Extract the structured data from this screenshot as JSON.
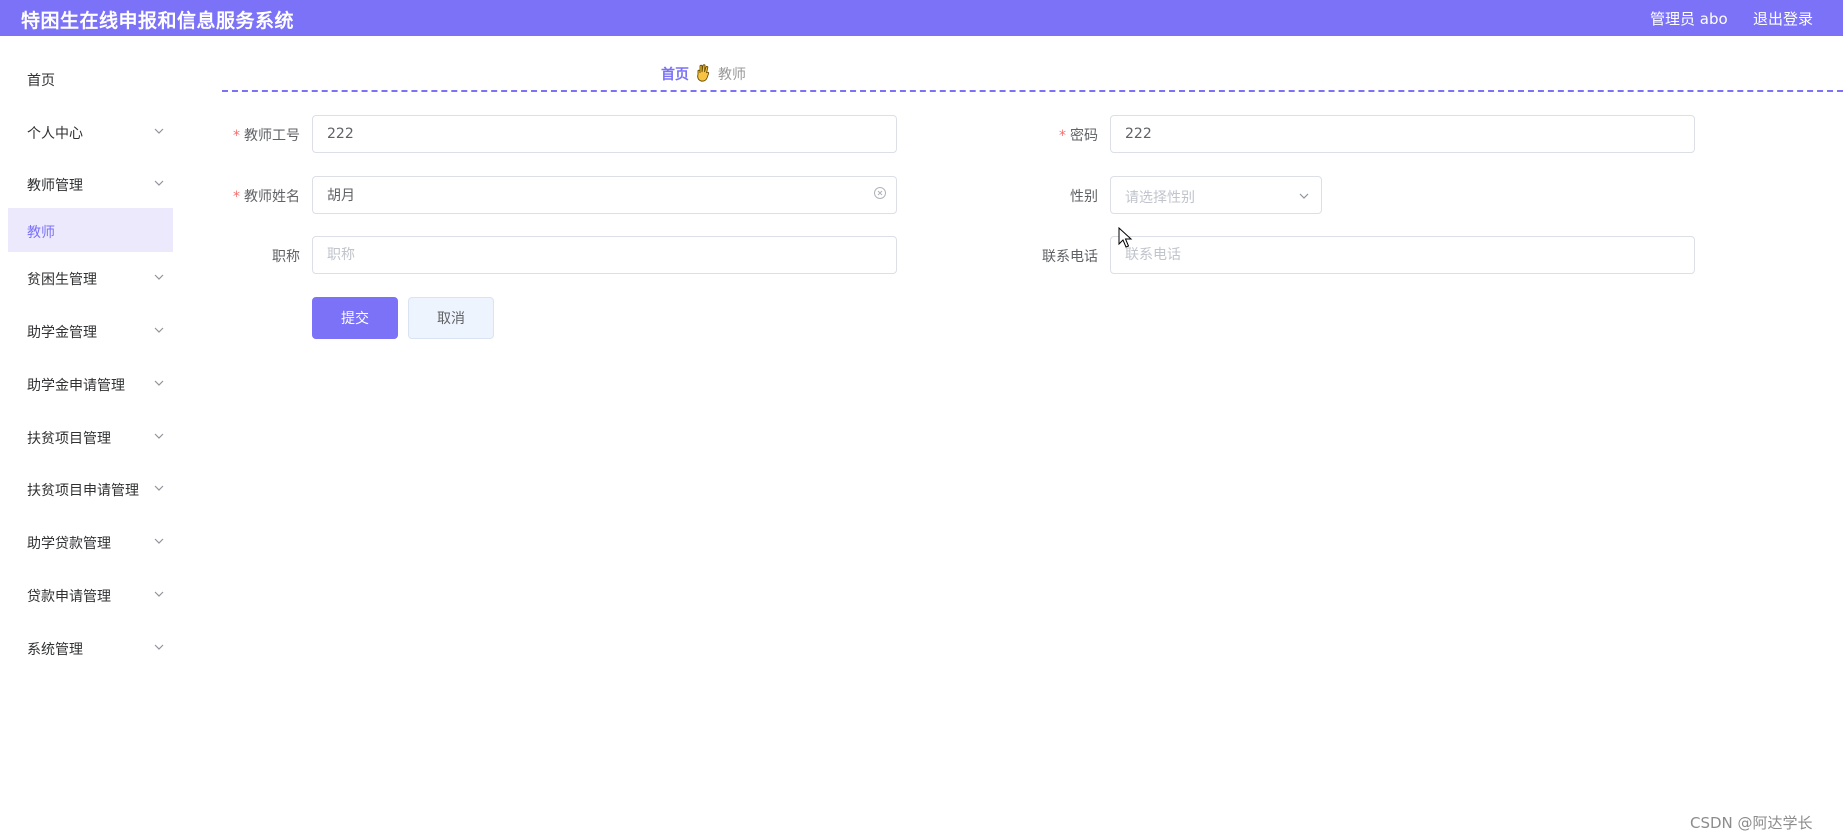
{
  "header": {
    "title": "特困生在线申报和信息服务系统",
    "user": "管理员 abo",
    "logout": "退出登录",
    "bg_color": "#7b72f7"
  },
  "sidebar": {
    "items": [
      {
        "label": "首页",
        "has_chevron": false
      },
      {
        "label": "个人中心",
        "has_chevron": true
      },
      {
        "label": "教师管理",
        "has_chevron": true
      },
      {
        "label": "教师",
        "has_chevron": false,
        "active": true
      },
      {
        "label": "贫困生管理",
        "has_chevron": true
      },
      {
        "label": "助学金管理",
        "has_chevron": true
      },
      {
        "label": "助学金申请管理",
        "has_chevron": true
      },
      {
        "label": "扶贫项目管理",
        "has_chevron": true
      },
      {
        "label": "扶贫项目申请管理",
        "has_chevron": true
      },
      {
        "label": "助学贷款管理",
        "has_chevron": true
      },
      {
        "label": "贷款申请管理",
        "has_chevron": true
      },
      {
        "label": "系统管理",
        "has_chevron": true
      }
    ],
    "active_color": "#7b72f7",
    "active_bg": "#ece9fd"
  },
  "breadcrumb": {
    "home": "首页",
    "separator_icon": "hand-icon",
    "current": "教师"
  },
  "form": {
    "teacher_id": {
      "label": "教师工号",
      "required": true,
      "value": "222"
    },
    "password": {
      "label": "密码",
      "required": true,
      "value": "222"
    },
    "teacher_name": {
      "label": "教师姓名",
      "required": true,
      "value": "胡月"
    },
    "gender": {
      "label": "性别",
      "required": false,
      "placeholder": "请选择性别"
    },
    "title": {
      "label": "职称",
      "required": false,
      "placeholder": "职称"
    },
    "phone": {
      "label": "联系电话",
      "required": false,
      "placeholder": "联系电话"
    },
    "submit": "提交",
    "cancel": "取消"
  },
  "watermark": "CSDN @阿达学长"
}
